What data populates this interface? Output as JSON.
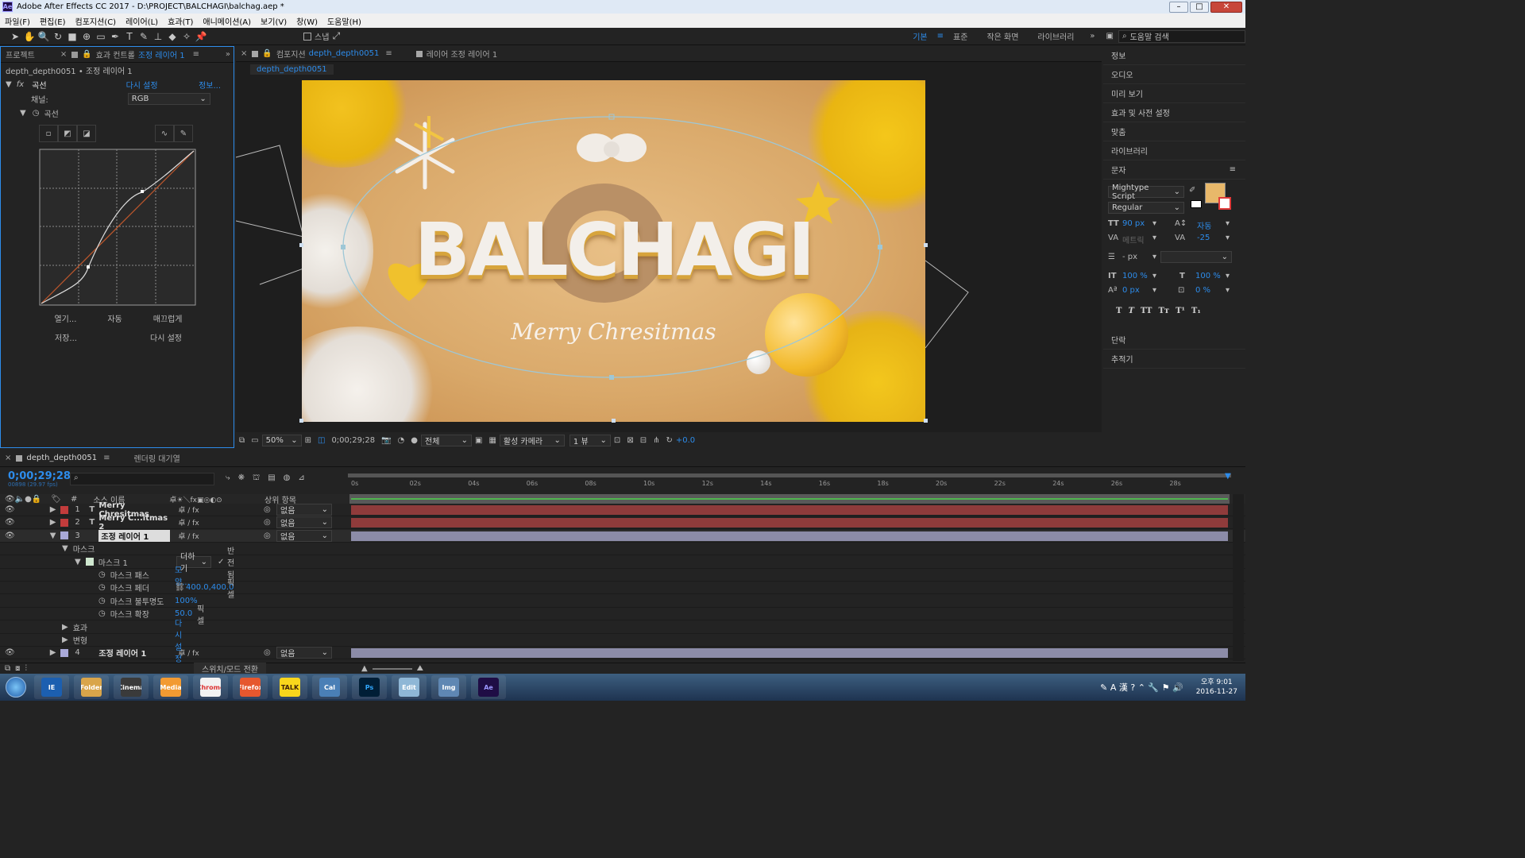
{
  "window": {
    "title": "Adobe After Effects CC 2017 - D:\\PROJECT\\BALCHAGI\\balchag.aep *",
    "app_icon": "Ae",
    "min": "–",
    "max": "□",
    "close": "✕"
  },
  "menu": [
    "파일(F)",
    "편집(E)",
    "컴포지션(C)",
    "레이어(L)",
    "효과(T)",
    "애니메이션(A)",
    "보기(V)",
    "창(W)",
    "도움말(H)"
  ],
  "toolbar": {
    "snap_label": "스냅",
    "workspaces": [
      "기본",
      "표준",
      "작은 화면",
      "라이브러리"
    ],
    "search_placeholder": "도움말 검색"
  },
  "effect_controls": {
    "project_tab": "프로젝트",
    "tab_label": "효과 컨트롤",
    "tab_layer": "조정 레이어 1",
    "subheader": "depth_depth0051 • 조정 레이어 1",
    "effect_name": "곡선",
    "reset": "다시 설정",
    "about": "정보...",
    "channel_label": "채널:",
    "channel_value": "RGB",
    "curves_label": "곡선",
    "btn_open": "열기...",
    "btn_auto": "자동",
    "btn_smooth": "매끄럽게",
    "btn_save": "저장...",
    "btn_reset": "다시 설정"
  },
  "composition": {
    "tab_label": "컴포지션",
    "tab_name": "depth_depth0051",
    "layer_tab": "레이어 조정 레이어 1",
    "flow_tab": "depth_depth0051",
    "title_text": "BALCHAGI",
    "script_text": "Merry Chresitmas",
    "zoom": "50%",
    "timecode": "0;00;29;28",
    "resolution": "전체",
    "camera": "활성 카메라",
    "views": "1 뷰",
    "exposure": "+0.0"
  },
  "right_panel": {
    "items": [
      "정보",
      "오디오",
      "미리 보기",
      "효과 및 사전 설정",
      "맞춤",
      "라이브러리"
    ],
    "char_title": "문자",
    "font": "Mightype Script",
    "style": "Regular",
    "font_size": "90 px",
    "leading": "자동",
    "kerning": "메트릭",
    "tracking": "-25",
    "stroke": "- px",
    "vscale": "100 %",
    "hscale": "100 %",
    "baseline": "0 px",
    "tsume": "0 %",
    "fill_color": "#e8b86a",
    "styles": [
      "T",
      "T",
      "TT",
      "Tт",
      "T¹",
      "T₁"
    ],
    "paragraph": "단락",
    "tracker": "추적기"
  },
  "timeline": {
    "tab": "depth_depth0051",
    "render_tab": "렌더링 대기열",
    "timecode": "0;00;29;28",
    "frame_info": "00898 (29.97 fps)",
    "col_num": "#",
    "col_source": "소스 이름",
    "col_parent": "상위 항목",
    "ruler": [
      "0s",
      "02s",
      "04s",
      "06s",
      "08s",
      "10s",
      "12s",
      "14s",
      "16s",
      "18s",
      "20s",
      "22s",
      "24s",
      "26s",
      "28s"
    ],
    "layers": [
      {
        "num": "1",
        "name": "Merry Chresitmas",
        "color": "#c23c3c",
        "type": "T",
        "parent": "없음"
      },
      {
        "num": "2",
        "name": "Merry C...itmas 2",
        "color": "#c23c3c",
        "type": "T",
        "parent": "없음"
      },
      {
        "num": "3",
        "name": "조정 레이어 1",
        "color": "#a9a9d8",
        "type": "",
        "parent": "없음"
      },
      {
        "num": "4",
        "name": "조정 레이어 1",
        "color": "#a9a9d8",
        "type": "",
        "parent": "없음"
      }
    ],
    "masks_label": "마스크",
    "mask1_label": "마스크 1",
    "mask_mode": "더하기",
    "inverted": "반전됨",
    "mask_path": "마스크 패스",
    "mask_path_value": "모양...",
    "mask_feather": "마스크 페더",
    "mask_feather_value": "400.0,400.0",
    "mask_opacity": "마스크 불투명도",
    "mask_opacity_value": "100%",
    "mask_expansion": "마스크 확장",
    "mask_expansion_value": "50.0",
    "pixel_unit": "픽셀",
    "effects_label": "효과",
    "transform_label": "변형",
    "transform_reset": "다시 설정",
    "toggle_label": "스위치/모드 전환"
  },
  "taskbar": {
    "time": "오후 9:01",
    "date": "2016-11-27",
    "apps": [
      "IE",
      "Folder",
      "Cinema",
      "Media",
      "Chrome",
      "Firefox",
      "TALK",
      "Cal",
      "Ps",
      "Edit",
      "Img",
      "Ae"
    ]
  }
}
